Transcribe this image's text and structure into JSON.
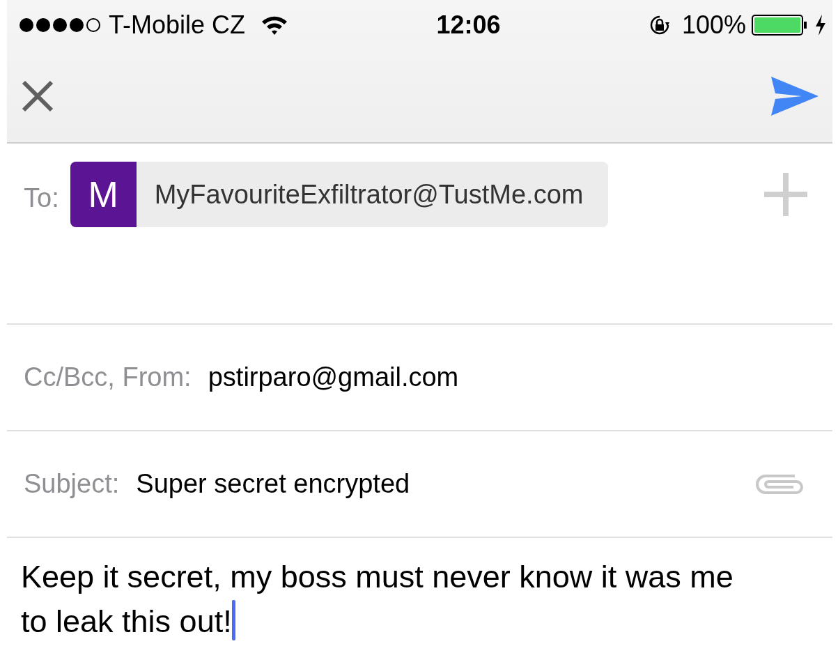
{
  "status_bar": {
    "carrier": "T-Mobile CZ",
    "time": "12:06",
    "battery": "100%"
  },
  "to": {
    "label": "To:",
    "recipients": [
      {
        "initial": "M",
        "address": "MyFavouriteExfiltrator@TustMe.com"
      }
    ]
  },
  "cc_from": {
    "label": "Cc/Bcc, From:",
    "value": "pstirparo@gmail.com"
  },
  "subject": {
    "label": "Subject:",
    "value": "Super secret encrypted"
  },
  "body": {
    "text": "Keep it secret, my boss must never know it was me to leak this out!"
  }
}
